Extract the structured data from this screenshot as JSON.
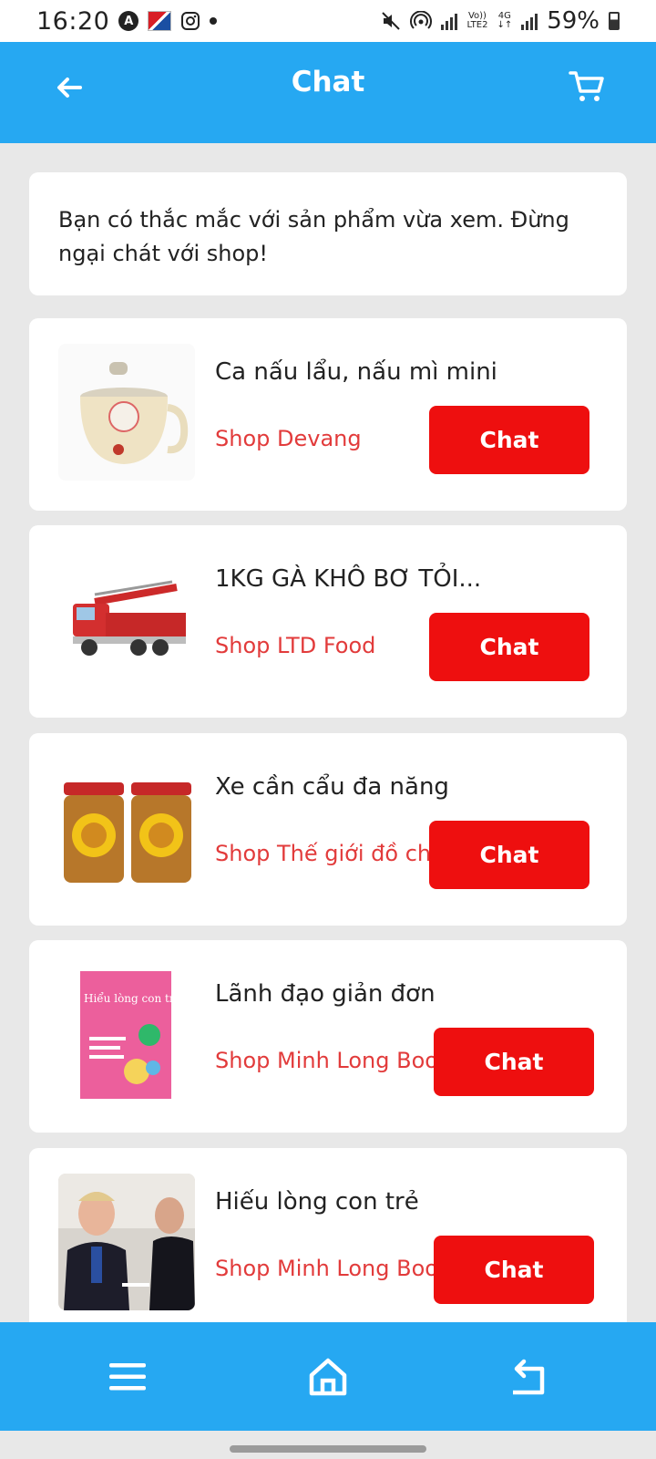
{
  "status_bar": {
    "time": "16:20",
    "battery": "59%",
    "network_label_top": "Vo))",
    "network_label_bottom": "LTE2",
    "network_type": "4G",
    "icons": [
      "a-circle-icon",
      "vietnam-app-icon",
      "instagram-icon",
      "dot-icon",
      "mute-icon",
      "hotspot-icon",
      "signal-icon",
      "battery-icon"
    ]
  },
  "header": {
    "title": "Chat",
    "back_icon": "arrow-left-icon",
    "cart_icon": "cart-icon"
  },
  "notice": {
    "text": "Bạn có thắc mắc với sản phẩm vừa xem. Đừng ngại chát với shop!"
  },
  "items": [
    {
      "name": "Ca nấu lẩu, nấu mì mini",
      "shop": "Shop Devang",
      "button": "Chat",
      "image": "electric-pot-image"
    },
    {
      "name": "1KG GÀ KHÔ BƠ TỎI...",
      "shop": "Shop LTD Food",
      "button": "Chat",
      "image": "fire-truck-toy-image"
    },
    {
      "name": "Xe cần cẩu đa năng",
      "shop": "Shop Thế giới đồ chơi",
      "button": "Chat",
      "image": "dried-chicken-jars-image"
    },
    {
      "name": "Lãnh đạo giản đơn",
      "shop": "Shop Minh Long Book",
      "button": "Chat",
      "image": "book-cover-image"
    },
    {
      "name": "Hiếu lòng con trẻ",
      "shop": "Shop Minh Long Book",
      "button": "Chat",
      "image": "dinner-photo-image"
    }
  ],
  "book_cover_text": "Hiểu lòng con trẻ",
  "bottom_nav": {
    "menu_icon": "menu-icon",
    "home_icon": "home-icon",
    "return_icon": "return-icon"
  },
  "colors": {
    "primary": "#26a8f2",
    "chat_button": "#ee0f0f",
    "shop_text": "#e23b3b",
    "background": "#e8e8e8"
  }
}
